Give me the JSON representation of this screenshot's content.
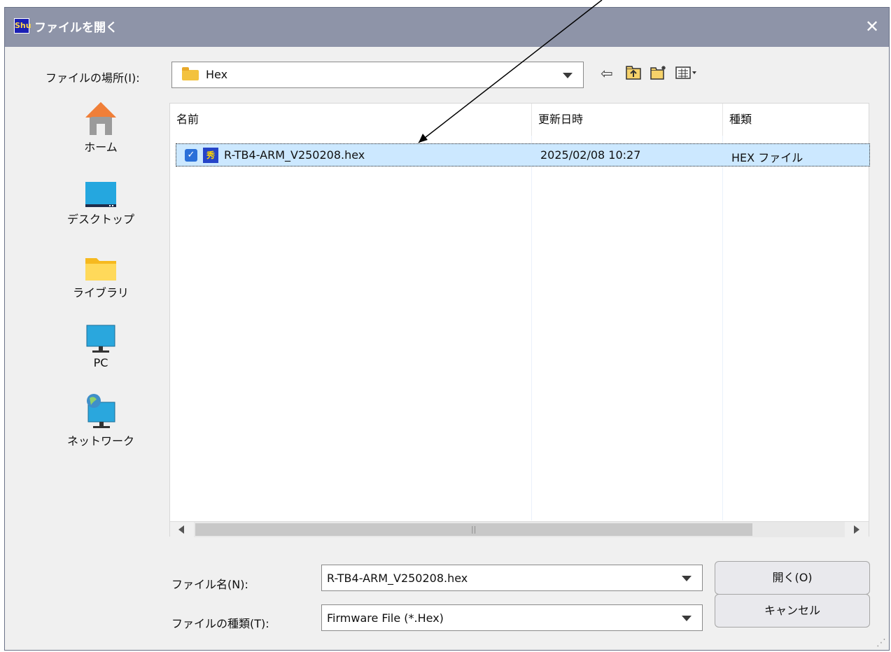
{
  "window": {
    "title": "ファイルを開く",
    "app_icon_text": "Shu",
    "close_symbol": "✕"
  },
  "lookin": {
    "label": "ファイルの場所(I):",
    "value": "Hex"
  },
  "toolbar": {
    "icons": [
      "back-icon",
      "up-folder-icon",
      "new-folder-icon",
      "view-menu-icon"
    ]
  },
  "places": [
    {
      "label": "ホーム",
      "icon": "home-icon"
    },
    {
      "label": "デスクトップ",
      "icon": "desktop-icon"
    },
    {
      "label": "ライブラリ",
      "icon": "library-folder-icon"
    },
    {
      "label": "PC",
      "icon": "pc-monitor-icon"
    },
    {
      "label": "ネットワーク",
      "icon": "network-icon"
    }
  ],
  "filelist": {
    "columns": [
      "名前",
      "更新日時",
      "種類"
    ],
    "rows": [
      {
        "name": "R-TB4-ARM_V250208.hex",
        "modified": "2025/02/08 10:27",
        "type": "HEX ファイル",
        "selected": true
      }
    ]
  },
  "form": {
    "filename_label": "ファイル名(N):",
    "filename_value": "R-TB4-ARM_V250208.hex",
    "filetype_label": "ファイルの種類(T):",
    "filetype_value": "Firmware File (*.Hex)"
  },
  "buttons": {
    "open": "開く(O)",
    "cancel": "キャンセル"
  },
  "colors": {
    "titlebar": "#8e94a8",
    "selection": "#cce8ff",
    "accent": "#2a6fd8"
  }
}
